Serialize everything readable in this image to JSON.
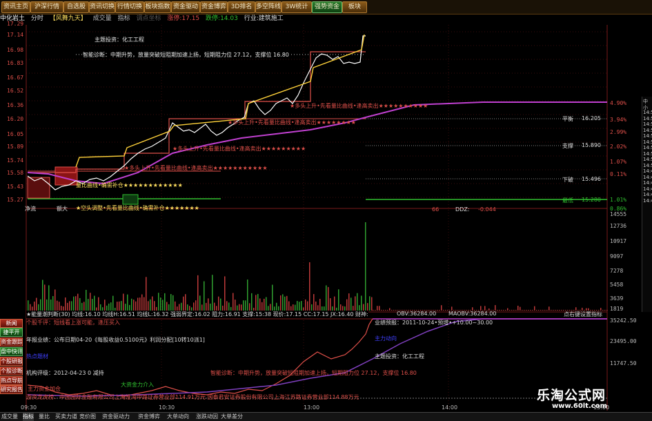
{
  "toolbar": {
    "tabs": [
      {
        "label": "资讯主页"
      },
      {
        "label": "沪深行情"
      },
      {
        "label": "自选股"
      },
      {
        "label": "资讯切换"
      },
      {
        "label": "行情切换"
      },
      {
        "label": "板块指数"
      },
      {
        "label": "资金驱动"
      },
      {
        "label": "资金博弈"
      },
      {
        "label": "3D排名"
      },
      {
        "label": "多空阵线"
      },
      {
        "label": "3W统计"
      },
      {
        "label": "强势资金"
      },
      {
        "label": "板块"
      }
    ],
    "active_tab": "强势资金"
  },
  "header": {
    "stock_name": "中化岩土",
    "period": "分时",
    "indicator_name": "【风舞九天】",
    "volume_label": "成交量",
    "index_label": "指标",
    "adjust": "调点坐标",
    "limit_up": "涨停:17.15",
    "limit_down": "跌停:14.03",
    "industry": "行业:建筑施工"
  },
  "price_axis": {
    "labels": [
      "17.29",
      "17.14",
      "16.98",
      "16.83",
      "16.67",
      "16.52",
      "16.36",
      "16.20",
      "16.05",
      "15.89",
      "15.74",
      "15.58",
      "15.43",
      "15.27"
    ]
  },
  "pct_axis": {
    "labels": [
      "4.90%",
      "3.94%",
      "2.99%",
      "2.02%",
      "1.07%",
      "0.11%",
      "0.86%",
      "1.01%"
    ]
  },
  "volume_axis": {
    "labels": [
      "14555",
      "12736",
      "10917",
      "9097",
      "7278",
      "5458",
      "3639",
      "1819"
    ]
  },
  "lower_axis": {
    "labels": [
      "35242.50",
      "23495.00",
      "11747.50"
    ]
  },
  "annotations": {
    "theme": "主题投资：化工工程",
    "diagnosis": "智能诊断：中期升势，放量突破短阻期加速上扬，短期阻力位 27.12，支撑位 16.80",
    "sig1": "★多头上升•先看量比曲线•逢高卖出★★★★★★★★★★",
    "sig2": "★多头上升•先看量比曲线•逢高卖出★★★★★★★★",
    "sig3": "★多头上升•先看量比曲线•逢高卖出★★★★★★★★★",
    "sig4": "★多头上升•先看量比曲线•逢高卖出★★★★★★★★★★★",
    "sig5": "量比曲线•确需补仓★★★★★★★★★★★★",
    "sig6": "★空头调整•先看量比曲线•确需补仓★★★★★★★",
    "left_label1": "净流",
    "left_label2": "额大",
    "right_line_1": "平衡",
    "right_val_1": "16.205",
    "right_line_2": "支撑",
    "right_val_2": "15.890",
    "right_line_3": "下破",
    "right_val_3": "15.496",
    "right_line_4": "最低",
    "right_val_4": "15.280",
    "ddz": "DDZ:",
    "ddz_val": "-0.044",
    "ddz_num": "66"
  },
  "vol_info": {
    "text": "★能量潮判断(30)  均线:16.10  均线H:16.51  均线L:16.32  强弱界定:16.02  阻力:16.91  支撑:15:38  现价:17.15  CC:17.15  JX:16.40  财神:",
    "obv": "OBV:36284.00",
    "maobv": "MAOBV:36284.00",
    "right_hint": "点右键设置指标"
  },
  "lower": {
    "warn": "个股千评：短线看上涨可能，逢压买入",
    "report": "年报业绩：公布日期04-20《每股收益0.5100元》利润分配[10转10派1]",
    "profit_label": "业绩预报：2011-10-24•预增•+10.00~30.00",
    "hot": "热点题材",
    "org": "机构评级：2012-04-23  0  减持",
    "theme2": "主题投资：化工工程",
    "diag2": "智能诊断：中期升势，放量突破短阻期加速上扬，短期阻力位 27.12，支撑位 16.80",
    "main": "主力动向",
    "fund_a": "大资金力介入",
    "fund_b": "主力资金加仓",
    "trade": "游资龙虎榜：中国国际金融有限公司上海淮海中路证券营业部114.91万元  国泰君安证券股份有限公司上海江苏路证券营业部114.88万元"
  },
  "side_buttons": [
    {
      "label": "新闻"
    },
    {
      "label": "捷平开"
    },
    {
      "label": "资金跟踪"
    },
    {
      "label": "盘中快讯"
    },
    {
      "label": "个股研报"
    },
    {
      "label": "个股诊断"
    },
    {
      "label": "热点导航"
    },
    {
      "label": "研究报告"
    }
  ],
  "time_axis": [
    "09:30",
    "10:30",
    "13:00",
    "14:00",
    "15:00"
  ],
  "bottom_tabs": [
    {
      "label": "成交量"
    },
    {
      "label": "指标"
    },
    {
      "label": "量比"
    },
    {
      "label": "买卖力道"
    },
    {
      "label": "竞价图"
    },
    {
      "label": "资金驱动力"
    },
    {
      "label": "资金博弈"
    },
    {
      "label": "大单动向"
    },
    {
      "label": "涨跌动因"
    },
    {
      "label": "大单差分"
    }
  ],
  "panel": {
    "labels": [
      "中",
      "小",
      "14:59",
      "14:58",
      "14:57",
      "14:56",
      "14:55",
      "14:54",
      "14:53",
      "14:52",
      "14:51",
      "14:50",
      "14:49",
      "14:48",
      "14:47",
      "14:46",
      "14:45",
      "14:44"
    ]
  },
  "watermark": {
    "cn": "乐淘公式网",
    "url": "www.60lt.com"
  },
  "colors": {
    "up": "#e0504a",
    "down": "#30c030",
    "price": "#ffffff",
    "avg": "#ffd23a",
    "trend": "#c040d0",
    "grid": "#7a1a1a"
  }
}
